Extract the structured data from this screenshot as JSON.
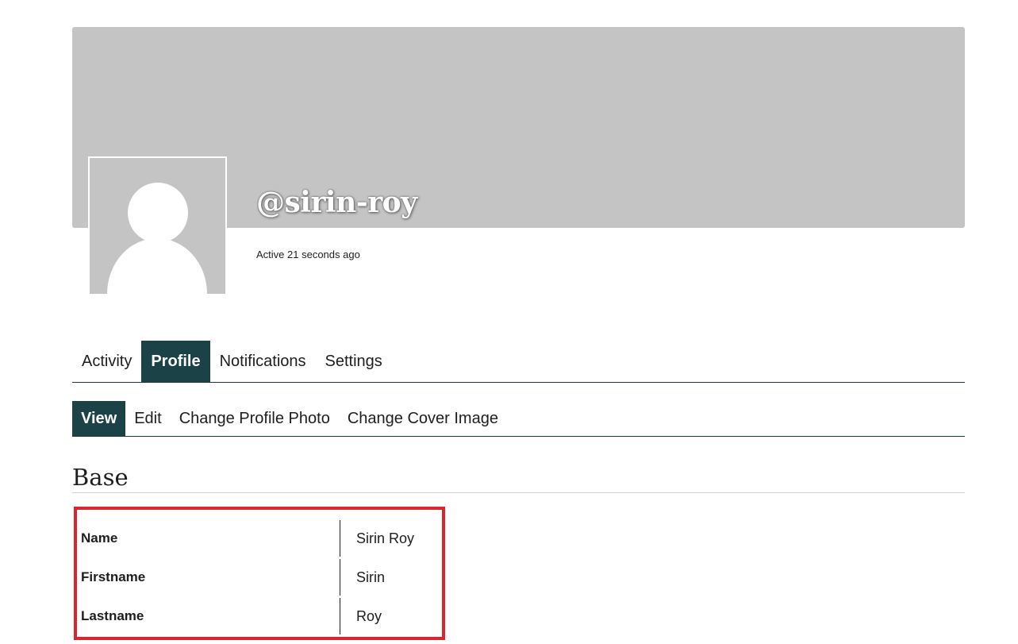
{
  "profile": {
    "username": "@sirin-roy",
    "last_active": "Active 21 seconds ago"
  },
  "primary_nav": {
    "tabs": [
      {
        "label": "Activity",
        "active": false
      },
      {
        "label": "Profile",
        "active": true
      },
      {
        "label": "Notifications",
        "active": false
      },
      {
        "label": "Settings",
        "active": false
      }
    ]
  },
  "secondary_nav": {
    "tabs": [
      {
        "label": "View",
        "active": true
      },
      {
        "label": "Edit",
        "active": false
      },
      {
        "label": "Change Profile Photo",
        "active": false
      },
      {
        "label": "Change Cover Image",
        "active": false
      }
    ]
  },
  "group": {
    "title": "Base",
    "fields": [
      {
        "label": "Name",
        "value": "Sirin Roy"
      },
      {
        "label": "Firstname",
        "value": "Sirin"
      },
      {
        "label": "Lastname",
        "value": "Roy"
      }
    ]
  },
  "colors": {
    "accent": "#1b4246",
    "cover": "#c4c4c4",
    "highlight": "#d7262e"
  }
}
